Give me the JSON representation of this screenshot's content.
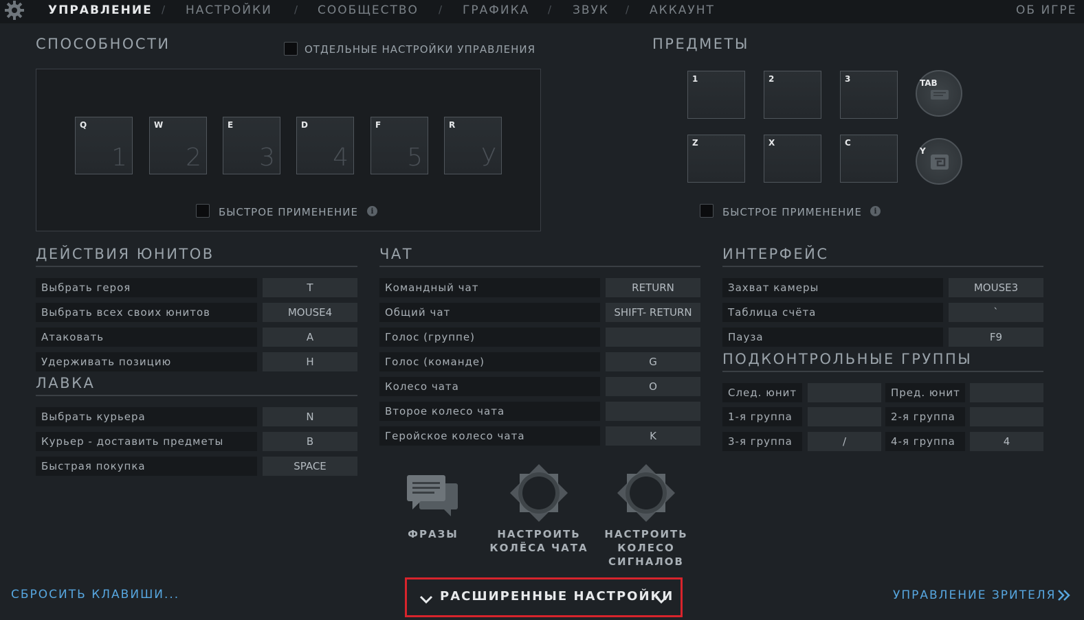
{
  "nav": {
    "tabs": [
      "УПРАВЛЕНИЕ",
      "НАСТРОЙКИ",
      "СООБЩЕСТВО",
      "ГРАФИКА",
      "ЗВУК",
      "АККАУНТ"
    ],
    "separator": "/",
    "about": "ОБ ИГРЕ"
  },
  "abilities": {
    "title": "СПОСОБНОСТИ",
    "separate_controls_label": "ОТДЕЛЬНЫЕ НАСТРОЙКИ УПРАВЛЕНИЯ",
    "slots": [
      {
        "key": "Q",
        "num": "1"
      },
      {
        "key": "W",
        "num": "2"
      },
      {
        "key": "E",
        "num": "3"
      },
      {
        "key": "D",
        "num": "4"
      },
      {
        "key": "F",
        "num": "5"
      },
      {
        "key": "R",
        "num": "У"
      }
    ],
    "quickcast_label": "БЫСТРОЕ ПРИМЕНЕНИЕ"
  },
  "items": {
    "title": "ПРЕДМЕТЫ",
    "slots": [
      "1",
      "2",
      "3",
      "Z",
      "X",
      "C"
    ],
    "tab_key": "TAB",
    "y_key": "Y",
    "quickcast_label": "БЫСТРОЕ ПРИМЕНЕНИЕ"
  },
  "unit_actions": {
    "title": "ДЕЙСТВИЯ ЮНИТОВ",
    "rows": [
      {
        "label": "Выбрать героя",
        "key": "T"
      },
      {
        "label": "Выбрать всех своих юнитов",
        "key": "MOUSE4"
      },
      {
        "label": "Атаковать",
        "key": "A"
      },
      {
        "label": "Удерживать позицию",
        "key": "H"
      }
    ]
  },
  "shop": {
    "title": "ЛАВКА",
    "rows": [
      {
        "label": "Выбрать курьера",
        "key": "N"
      },
      {
        "label": "Курьер - доставить предметы",
        "key": "B"
      },
      {
        "label": "Быстрая покупка",
        "key": "SPACE"
      }
    ]
  },
  "chat": {
    "title": "ЧАТ",
    "rows": [
      {
        "label": "Командный чат",
        "key": "RETURN"
      },
      {
        "label": "Общий чат",
        "key": "SHIFT- RETURN"
      },
      {
        "label": "Голос (группе)",
        "key": ""
      },
      {
        "label": "Голос (команде)",
        "key": "G"
      },
      {
        "label": "Колесо чата",
        "key": "O"
      },
      {
        "label": "Второе колесо чата",
        "key": ""
      },
      {
        "label": "Геройское колесо чата",
        "key": "K"
      }
    ],
    "buttons": {
      "phrases": "ФРАЗЫ",
      "chat_wheel_1": "НАСТРОИТЬ",
      "chat_wheel_2": "КОЛЁСА ЧАТА",
      "ping_wheel_1": "НАСТРОИТЬ",
      "ping_wheel_2": "КОЛЕСО",
      "ping_wheel_3": "СИГНАЛОВ"
    }
  },
  "interface": {
    "title": "ИНТЕРФЕЙС",
    "rows": [
      {
        "label": "Захват камеры",
        "key": "MOUSE3"
      },
      {
        "label": "Таблица счёта",
        "key": "`"
      },
      {
        "label": "Пауза",
        "key": "F9"
      }
    ]
  },
  "control_groups": {
    "title": "ПОДКОНТРОЛЬНЫЕ ГРУППЫ",
    "rows": [
      [
        {
          "label": "След. юнит",
          "key": ""
        },
        {
          "label": "Пред. юнит",
          "key": ""
        }
      ],
      [
        {
          "label": "1-я группа",
          "key": ""
        },
        {
          "label": "2-я группа",
          "key": ""
        }
      ],
      [
        {
          "label": "3-я группа",
          "key": "/"
        },
        {
          "label": "4-я группа",
          "key": "4"
        }
      ]
    ]
  },
  "footer": {
    "reset": "СБРОСИТЬ КЛАВИШИ...",
    "advanced": "РАСШИРЕННЫЕ НАСТРОЙКИ",
    "spectator": "УПРАВЛЕНИЕ ЗРИТЕЛЯ"
  },
  "colors": {
    "background": "#1e2226",
    "link": "#57a7e0",
    "highlight_border": "#d8242c"
  }
}
